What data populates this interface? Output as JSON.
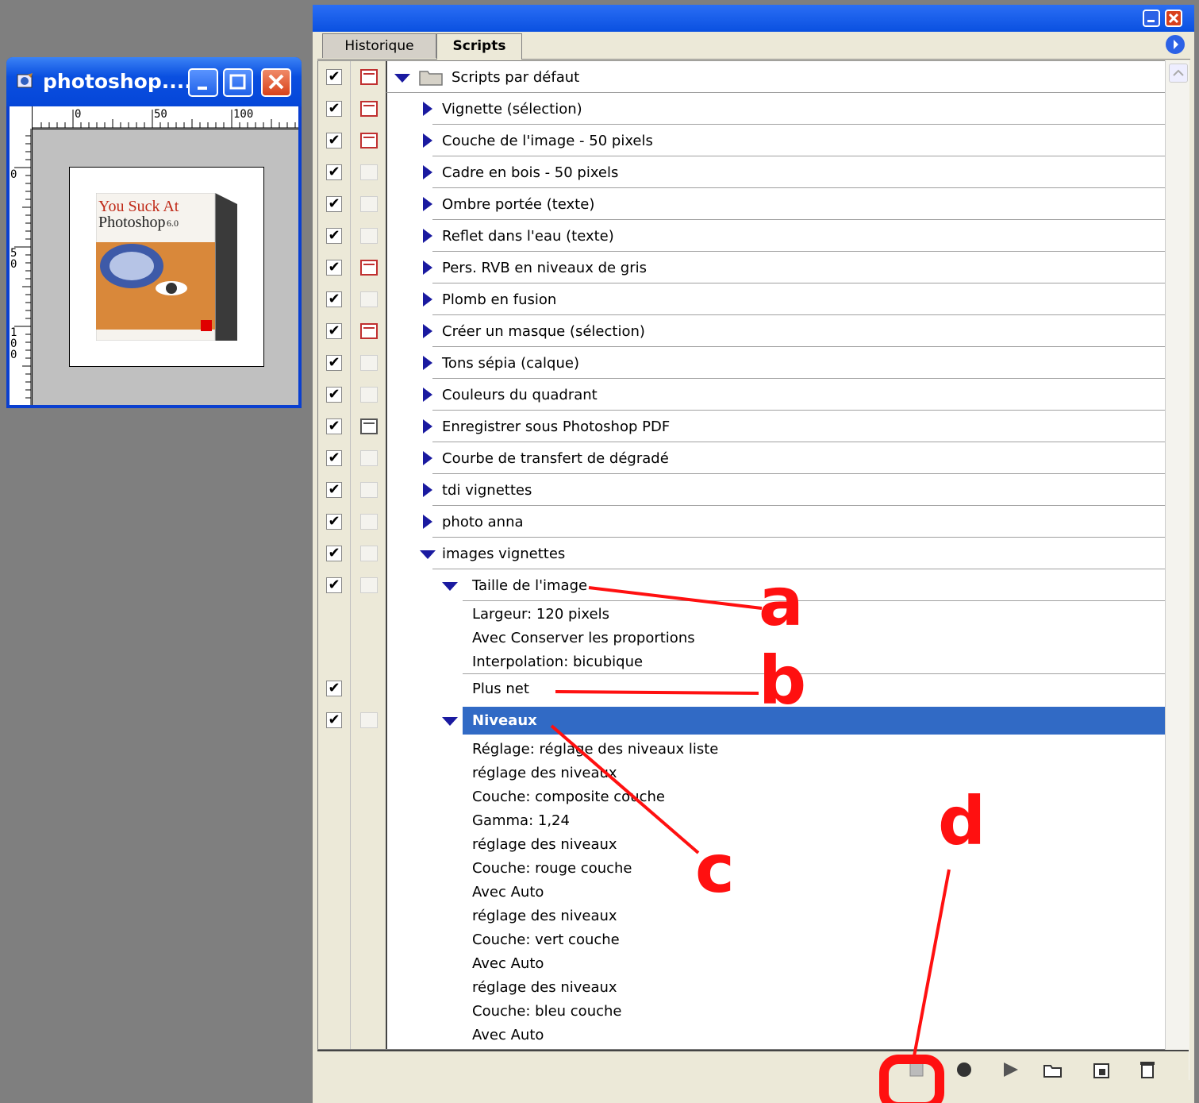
{
  "document_window": {
    "title": "photoshop....",
    "ruler_top": [
      "0",
      "50",
      "100"
    ],
    "ruler_left": [
      "0",
      "50",
      "100"
    ],
    "thumbnail_text_1": "You Suck At",
    "thumbnail_text_2": "Photoshop",
    "thumbnail_text_3": "6.0"
  },
  "palette": {
    "tabs": [
      {
        "label": "Historique"
      },
      {
        "label": "Scripts"
      }
    ],
    "rows": [
      {
        "label": "Scripts par défaut",
        "checked": true,
        "dialog": "on",
        "expander": "down",
        "indent": 0,
        "folder": true
      },
      {
        "label": "Vignette (sélection)",
        "checked": true,
        "dialog": "on",
        "expander": "right",
        "indent": 1
      },
      {
        "label": "Couche de l'image - 50 pixels",
        "checked": true,
        "dialog": "on",
        "expander": "right",
        "indent": 1
      },
      {
        "label": "Cadre en bois - 50 pixels",
        "checked": true,
        "dialog": "empty",
        "expander": "right",
        "indent": 1
      },
      {
        "label": "Ombre portée (texte)",
        "checked": true,
        "dialog": "empty",
        "expander": "right",
        "indent": 1
      },
      {
        "label": "Reflet dans l'eau (texte)",
        "checked": true,
        "dialog": "empty",
        "expander": "right",
        "indent": 1
      },
      {
        "label": "Pers. RVB en niveaux de gris",
        "checked": true,
        "dialog": "on",
        "expander": "right",
        "indent": 1
      },
      {
        "label": "Plomb en fusion",
        "checked": true,
        "dialog": "empty",
        "expander": "right",
        "indent": 1
      },
      {
        "label": "Créer un masque (sélection)",
        "checked": true,
        "dialog": "on",
        "expander": "right",
        "indent": 1
      },
      {
        "label": "Tons sépia (calque)",
        "checked": true,
        "dialog": "empty",
        "expander": "right",
        "indent": 1
      },
      {
        "label": "Couleurs du quadrant",
        "checked": true,
        "dialog": "empty",
        "expander": "right",
        "indent": 1
      },
      {
        "label": "Enregistrer sous Photoshop PDF",
        "checked": true,
        "dialog": "gray",
        "expander": "right",
        "indent": 1
      },
      {
        "label": "Courbe de transfert de dégradé",
        "checked": true,
        "dialog": "empty",
        "expander": "right",
        "indent": 1
      },
      {
        "label": "tdi vignettes",
        "checked": true,
        "dialog": "empty",
        "expander": "right",
        "indent": 1
      },
      {
        "label": "photo anna",
        "checked": true,
        "dialog": "empty",
        "expander": "right",
        "indent": 1
      },
      {
        "label": "images vignettes",
        "checked": true,
        "dialog": "empty",
        "expander": "down",
        "indent": 1
      },
      {
        "label": "Taille de l'image",
        "checked": true,
        "dialog": "empty",
        "expander": "down",
        "indent": 2
      }
    ],
    "taille_details": [
      "Largeur: 120 pixels",
      "Avec Conserver les proportions",
      "Interpolation: bicubique"
    ],
    "plus_net": "Plus net",
    "niveaux": "Niveaux",
    "niveaux_details": [
      "Réglage: réglage des niveaux liste",
      "réglage des niveaux",
      "Couche: composite couche",
      "Gamma: 1,24",
      "réglage des niveaux",
      "Couche: rouge couche",
      "Avec Auto",
      "réglage des niveaux",
      "Couche: vert couche",
      "Avec Auto",
      "réglage des niveaux",
      "Couche: bleu couche",
      "Avec Auto"
    ],
    "bottom_icons": [
      "stop-icon",
      "record-icon",
      "play-icon",
      "folder-icon",
      "new-script-icon",
      "trash-icon"
    ]
  },
  "annotations": {
    "a": "a",
    "b": "b",
    "c": "c",
    "d": "d"
  },
  "colors": {
    "selection": "#316ac5",
    "annotation": "#ff1010",
    "xp_blue": "#0a50e0"
  }
}
